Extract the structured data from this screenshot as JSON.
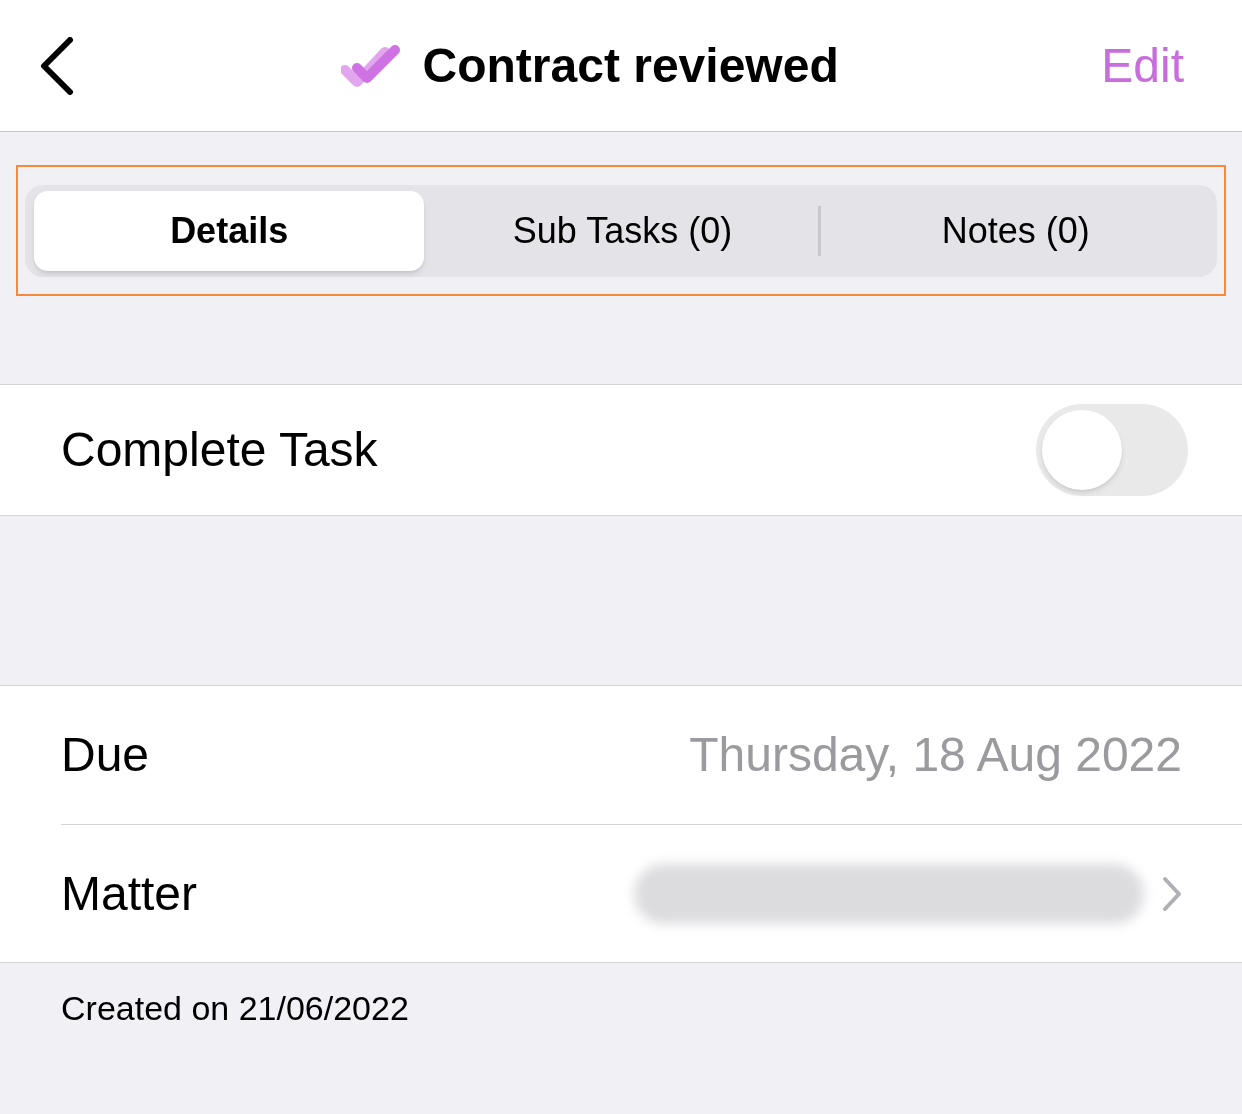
{
  "nav": {
    "title": "Contract reviewed",
    "edit": "Edit"
  },
  "segments": [
    {
      "label": "Details",
      "selected": true
    },
    {
      "label": "Sub Tasks (0)",
      "selected": false
    },
    {
      "label": "Notes (0)",
      "selected": false
    }
  ],
  "complete_task": {
    "label": "Complete Task",
    "on": false
  },
  "rows": [
    {
      "kind": "value",
      "label": "Due",
      "value": "Thursday, 18 Aug 2022"
    },
    {
      "kind": "redacted",
      "label": "Matter"
    }
  ],
  "footer": "Created on 21/06/2022"
}
